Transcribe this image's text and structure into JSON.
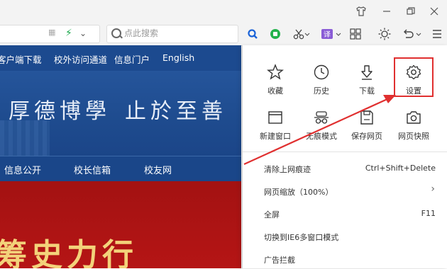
{
  "browser": {
    "search": {
      "placeholder": "点此搜索"
    }
  },
  "site": {
    "nav_top": [
      "客户端下载",
      "校外访问通道",
      "信息门户",
      "English"
    ],
    "motto_left": "厚德博學",
    "motto_right": "止於至善",
    "nav_main": [
      "信息公开",
      "校长信箱",
      "校友网"
    ],
    "banner_text": "筹史力行"
  },
  "menu": {
    "top_items": [
      {
        "label": "收藏",
        "icon": "star-icon"
      },
      {
        "label": "历史",
        "icon": "clock-icon"
      },
      {
        "label": "下载",
        "icon": "download-icon"
      },
      {
        "label": "设置",
        "icon": "gear-icon"
      }
    ],
    "second_items": [
      {
        "label": "新建窗口",
        "icon": "window-icon"
      },
      {
        "label": "无痕模式",
        "icon": "incognito-icon"
      },
      {
        "label": "保存网页",
        "icon": "save-icon"
      },
      {
        "label": "网页快照",
        "icon": "camera-icon"
      }
    ],
    "rows": [
      {
        "label": "清除上网痕迹",
        "shortcut": "Ctrl+Shift+Delete"
      },
      {
        "label": "网页缩放（100%）",
        "shortcut": ""
      },
      {
        "label": "全屏",
        "shortcut": "F11"
      },
      {
        "label": "切换到IE6多窗口模式",
        "shortcut": ""
      },
      {
        "label": "广告拦截",
        "shortcut": ""
      }
    ]
  },
  "colors": {
    "highlight": "#e03030",
    "site_blue": "#1c4a8f",
    "site_red": "#b51515"
  }
}
